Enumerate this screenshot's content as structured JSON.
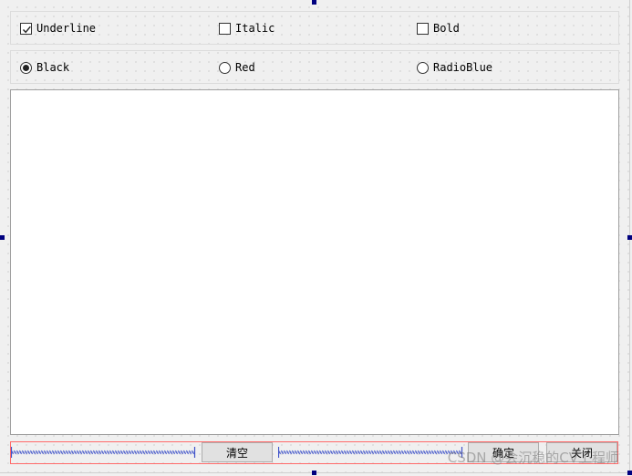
{
  "options_row": {
    "underline_label": "Underline",
    "underline_checked": true,
    "italic_label": "Italic",
    "italic_checked": false,
    "bold_label": "Bold",
    "bold_checked": false
  },
  "color_row": {
    "black_label": "Black",
    "red_label": "Red",
    "blue_label": "RadioBlue",
    "selected": "Black"
  },
  "text_area": {
    "value": ""
  },
  "button_row": {
    "clear_label": "清空",
    "ok_label": "确定",
    "close_label": "关闭"
  },
  "watermark": "CSDN @会沉稳的CV工程师",
  "colors": {
    "spacer": "#3f52c9",
    "layout_outline": "#ff6a6a",
    "selection_handle": "#00007f",
    "background": "#f0f0f0"
  }
}
